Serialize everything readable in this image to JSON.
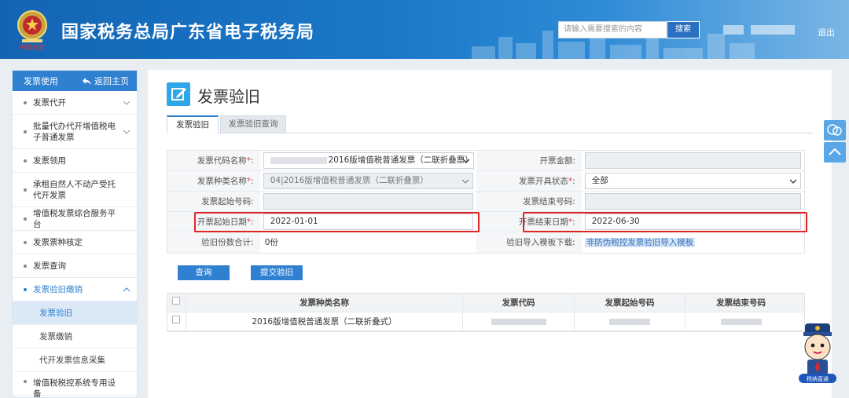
{
  "header": {
    "site_title": "国家税务总局广东省电子税务局",
    "emblem_text": "中国税务",
    "search_placeholder": "请输入需要搜索的内容",
    "search_button": "搜索",
    "logout": "退出",
    "brand_color": "#1a78c8"
  },
  "sidebar": {
    "section_title": "发票使用",
    "back_home": "返回主页",
    "items": [
      {
        "label": "发票代开",
        "expandable": true
      },
      {
        "label": "批量代办代开增值税电子普通发票",
        "expandable": true
      },
      {
        "label": "发票领用",
        "expandable": false
      },
      {
        "label": "承租自然人不动产受托代开发票",
        "expandable": false
      },
      {
        "label": "增值税发票综合服务平台",
        "expandable": false
      },
      {
        "label": "发票票种核定",
        "expandable": false
      },
      {
        "label": "发票查询",
        "expandable": false
      },
      {
        "label": "发票验旧缴销",
        "expandable": true,
        "expanded": true
      }
    ],
    "sub_items": [
      {
        "label": "发票验旧",
        "current": true
      },
      {
        "label": "发票缴销",
        "current": false
      },
      {
        "label": "代开发票信息采集",
        "current": false
      }
    ],
    "last_item": "增值税税控系统专用设备"
  },
  "page": {
    "title": "发票验旧",
    "tabs": [
      {
        "label": "发票验旧",
        "active": true
      },
      {
        "label": "发票验旧查询",
        "active": false
      }
    ]
  },
  "form": {
    "invoice_code_name_label": "发票代码名称",
    "invoice_code_name_value": "2016版增值税普通发票（二联折叠票）",
    "invoice_amount_label": "开票金额:",
    "invoice_type_name_label": "发票种类名称",
    "invoice_type_name_value": "04|2016版增值税普通发票（二联折叠票）",
    "issue_status_label": "发票开具状态",
    "issue_status_value": "全部",
    "start_number_label": "发票起始号码:",
    "end_number_label": "发票结束号码:",
    "start_date_label": "开票起始日期",
    "start_date_value": "2022-01-01",
    "end_date_label": "开票结束日期",
    "end_date_value": "2022-06-30",
    "count_total_label": "验旧份数合计:",
    "count_total_value": "0份",
    "template_label": "验旧导入模板下载:",
    "template_link": "非防伪税控发票验旧导入模板",
    "required_mark": "*",
    "colon": ":"
  },
  "buttons": {
    "query": "查询",
    "submit": "提交验旧"
  },
  "table": {
    "columns": [
      "发票种类名称",
      "发票代码",
      "发票起始号码",
      "发票结束号码"
    ],
    "rows": [
      {
        "type_name": "2016版增值税普通发票（二联折叠式）"
      }
    ]
  },
  "mascot_caption": "税纳直通",
  "highlight_color": "#e02424"
}
